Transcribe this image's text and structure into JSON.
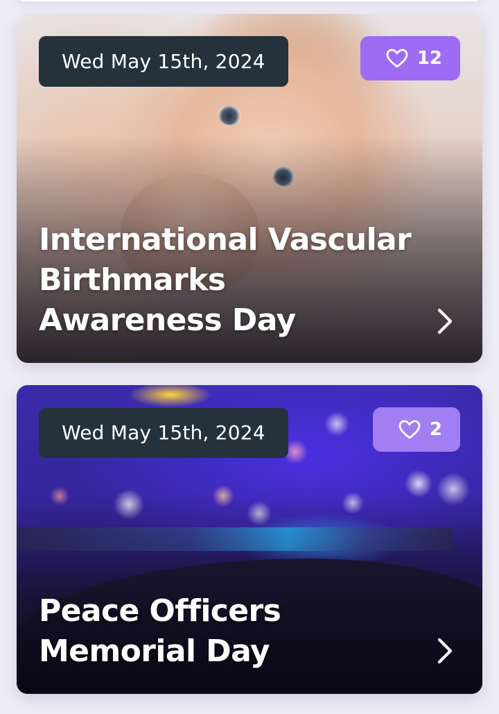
{
  "events": [
    {
      "date": "Wed May 15th, 2024",
      "likes": "12",
      "title": "International Vascular\nBirthmarks\nAwareness Day",
      "image": "baby-photo"
    },
    {
      "date": "Wed May 15th, 2024",
      "likes": "2",
      "title": "Peace Officers\nMemorial Day",
      "image": "police-lights-photo"
    }
  ],
  "icons": {
    "like": "heart-icon",
    "open": "chevron-right-icon"
  },
  "colors": {
    "date_pill": "#26323b",
    "like_badge": "#9e6cf2",
    "page_background": "#eeedf5"
  }
}
